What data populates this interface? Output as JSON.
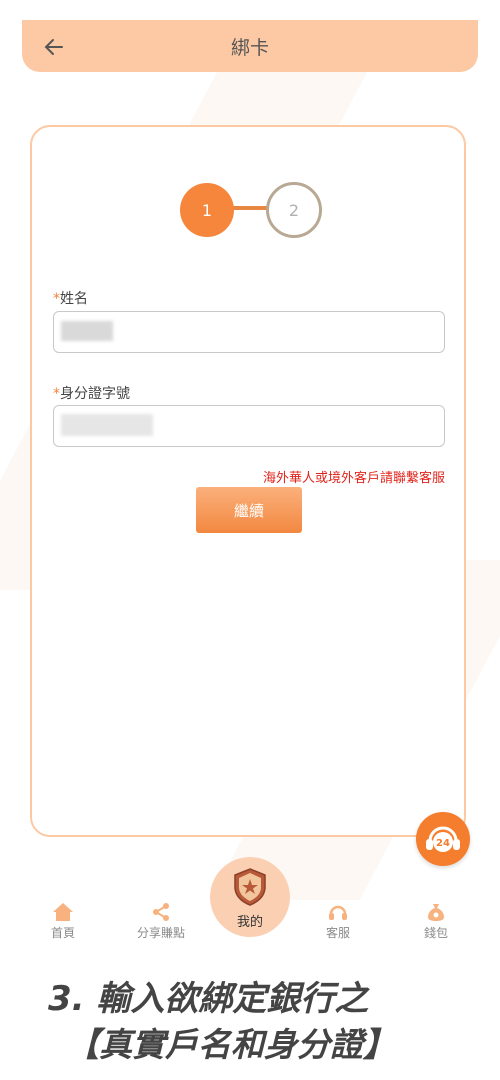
{
  "header": {
    "title": "綁卡",
    "back_icon": "arrow-left-icon"
  },
  "stepper": {
    "step1": "1",
    "step2": "2"
  },
  "form": {
    "name_required_mark": "*",
    "name_label": "姓名",
    "id_required_mark": "*",
    "id_label": "身分證字號",
    "overseas_note": "海外華人或境外客戶請聯繫客服",
    "continue_label": "繼續"
  },
  "support": {
    "icon": "customer-service-24-icon",
    "label": "24"
  },
  "bottom_nav": {
    "home": "首頁",
    "share": "分享賺點",
    "mine": "我的",
    "service": "客服",
    "wallet": "錢包"
  },
  "caption": {
    "line1": "3. 輸入欲綁定銀行之",
    "line2": "【真實戶名和身分證】"
  },
  "colors": {
    "accent": "#f5863b",
    "header_bg": "#fcc9a4",
    "error": "#e0241b"
  }
}
